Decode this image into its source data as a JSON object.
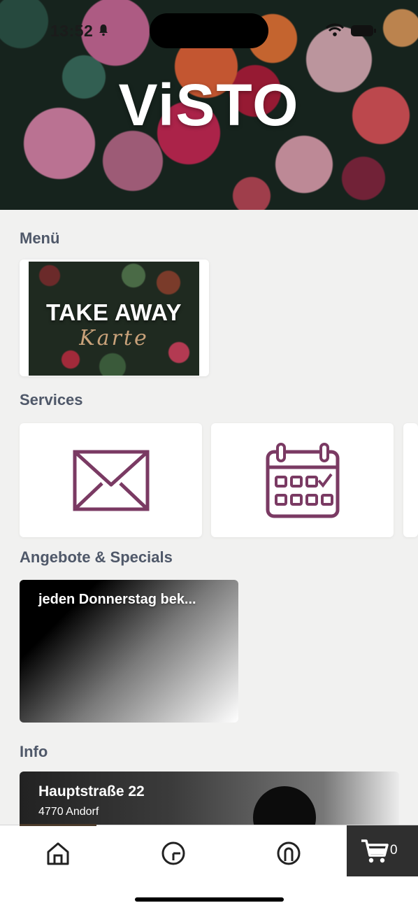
{
  "status_bar": {
    "time": "13:52"
  },
  "hero": {
    "logo_text": "ViSTO"
  },
  "sections": {
    "menu": "Menü",
    "services": "Services",
    "offers": "Angebote & Specials",
    "info": "Info"
  },
  "menu_card": {
    "title": "TAKE AWAY",
    "subtitle": "Karte"
  },
  "services": [
    {
      "icon": "envelope-icon"
    },
    {
      "icon": "calendar-icon"
    }
  ],
  "offer": {
    "text": "jeden Donnerstag bek..."
  },
  "info": {
    "street": "Hauptstraße 22",
    "city": "4770 Andorf"
  },
  "tabbar": {
    "tabs": [
      {
        "icon": "home-icon"
      },
      {
        "icon": "history-icon"
      },
      {
        "icon": "account-icon"
      }
    ],
    "cart_count": "0"
  },
  "colors": {
    "accent": "#7a3a63",
    "section_title": "#4f5869",
    "cart_bg": "#2f2f2f"
  }
}
